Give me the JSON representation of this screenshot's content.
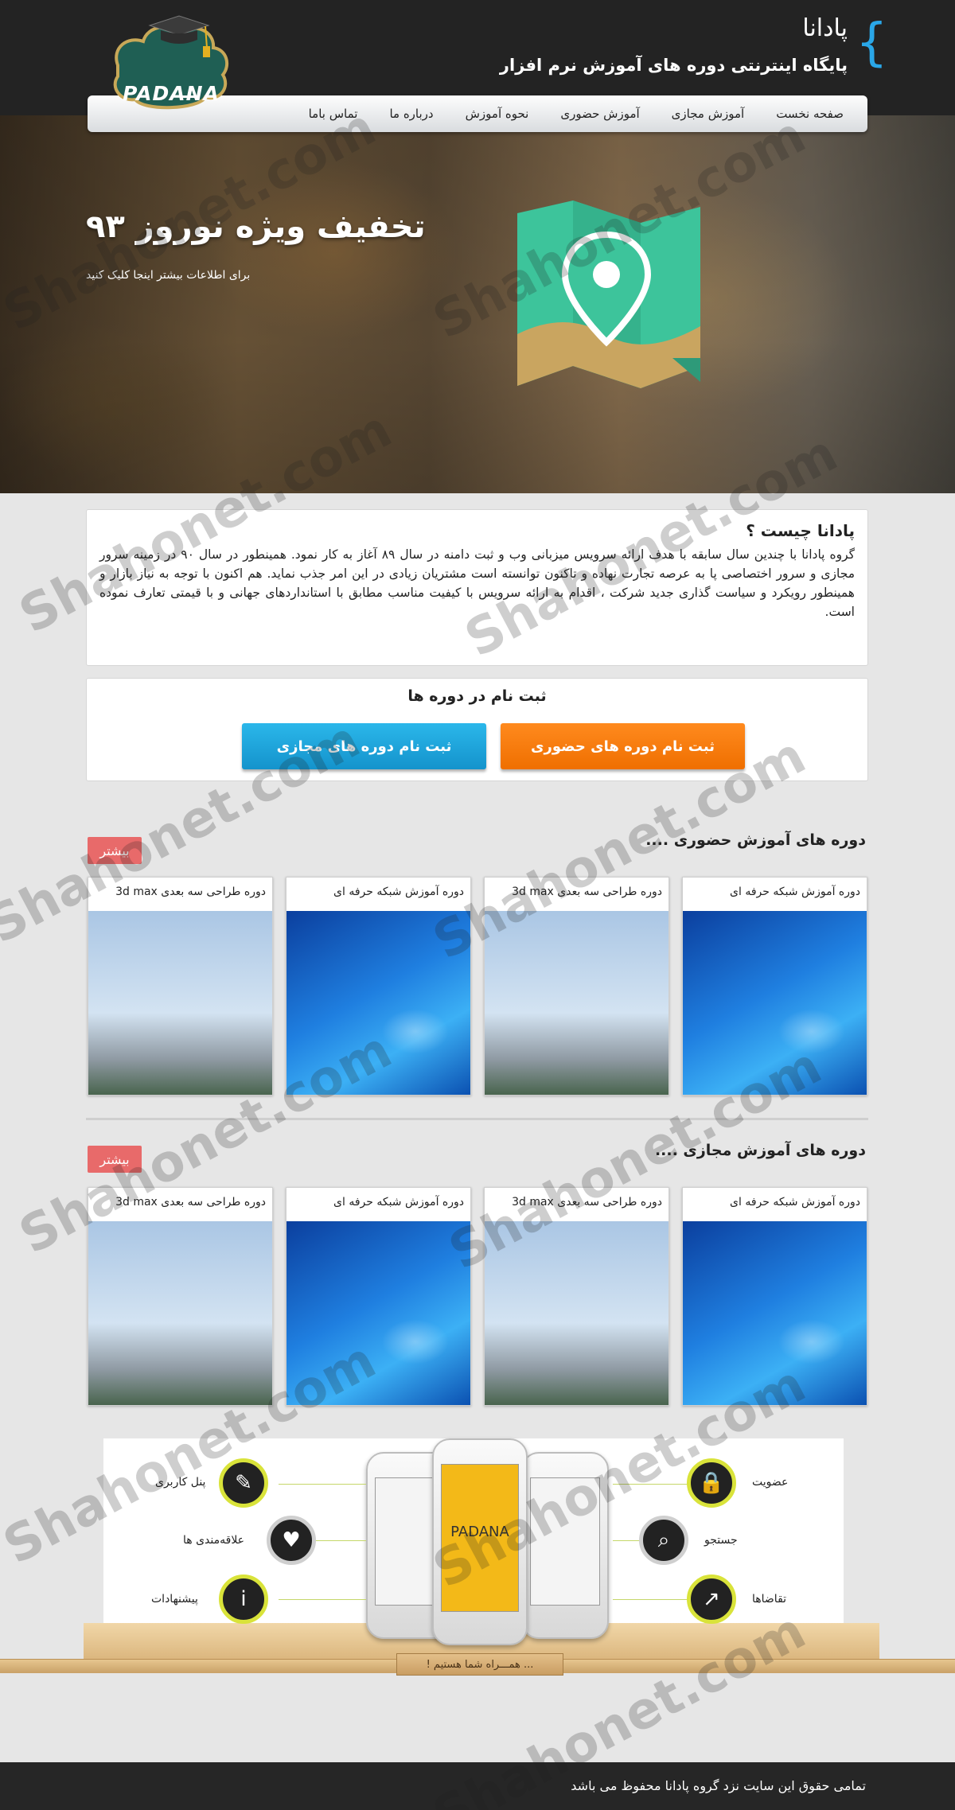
{
  "header": {
    "site_title": "پادانا",
    "site_subtitle": "پایگاه اینترنتی دوره های آموزش نرم افزار",
    "logo_text": "PADANA"
  },
  "nav": {
    "items": [
      {
        "label": "صفحه نخست"
      },
      {
        "label": "آموزش مجازی"
      },
      {
        "label": "آموزش حضوری"
      },
      {
        "label": "نحوه آموزش"
      },
      {
        "label": "درباره ما"
      },
      {
        "label": "تماس باما"
      }
    ]
  },
  "hero": {
    "title": "تخفیف ویژه نوروز ۹۳",
    "subtitle": "برای اطلاعات بیشتر اینجا کلیک کنید"
  },
  "about": {
    "title": "پادانا چیست ؟",
    "body": "گروه پادانا با چندین سال سابقه با هدف ارائه سرویس میزبانی وب و ثبت دامنه در سال ۸۹ آغاز به کار نمود. همینطور در سال ۹۰ در زمینه سرور مجازی و سرور اختصاصی پا به عرصه تجارت نهاده و تاکنون توانسته است مشتریان زیادی در این امر جذب نماید. هم اکنون با توجه به نیاز بازار و همینطور رویکرد و سیاست گذاری جدید شرکت ، اقدام به ارائه سرویس با کیفیت مناسب مطابق با استانداردهای جهانی و با قیمتی تعارف نموده است."
  },
  "register": {
    "title": "ثبت نام در دوره ها",
    "in_person_button": "ثبت نام دوره های حضوری",
    "online_button": "ثبت نام دوره های مجازی"
  },
  "in_person": {
    "title": "دوره های آموزش حضوری ....",
    "more": "بیشتر",
    "courses": [
      {
        "title": "دوره آموزش شبکه حرفه ای",
        "image": "network-cable"
      },
      {
        "title": "دوره طراحی سه بعدی 3d max",
        "image": "building"
      },
      {
        "title": "دوره آموزش شبکه حرفه ای",
        "image": "network-cable"
      },
      {
        "title": "دوره طراحی سه بعدی 3d max",
        "image": "building"
      }
    ]
  },
  "online": {
    "title": "دوره های آموزش مجازی ....",
    "more": "بیشتر",
    "courses": [
      {
        "title": "دوره آموزش شبکه حرفه ای",
        "image": "network-cable"
      },
      {
        "title": "دوره طراحی سه بعدی 3d max",
        "image": "building"
      },
      {
        "title": "دوره آموزش شبکه حرفه ای",
        "image": "network-cable"
      },
      {
        "title": "دوره طراحی سه بعدی 3d max",
        "image": "building"
      }
    ]
  },
  "mobile": {
    "phone_label": "PADANA",
    "features_right": [
      "عضویت",
      "جستجو",
      "تقاضاها"
    ],
    "features_left": [
      "پنل کاربری",
      "علاقه‌مندی ها",
      "پیشنهادات"
    ],
    "tagline": "... همـــراه شما هستیم !"
  },
  "footer": {
    "copyright": "تمامی حقوق این سایت نزد گروه پادانا محفوظ می باشد"
  },
  "watermark": "Shahonet.com",
  "colors": {
    "accent_blue": "#1493cc",
    "accent_orange": "#ef6f00",
    "more_badge": "#e86a6a",
    "dark_bar": "#232323"
  }
}
